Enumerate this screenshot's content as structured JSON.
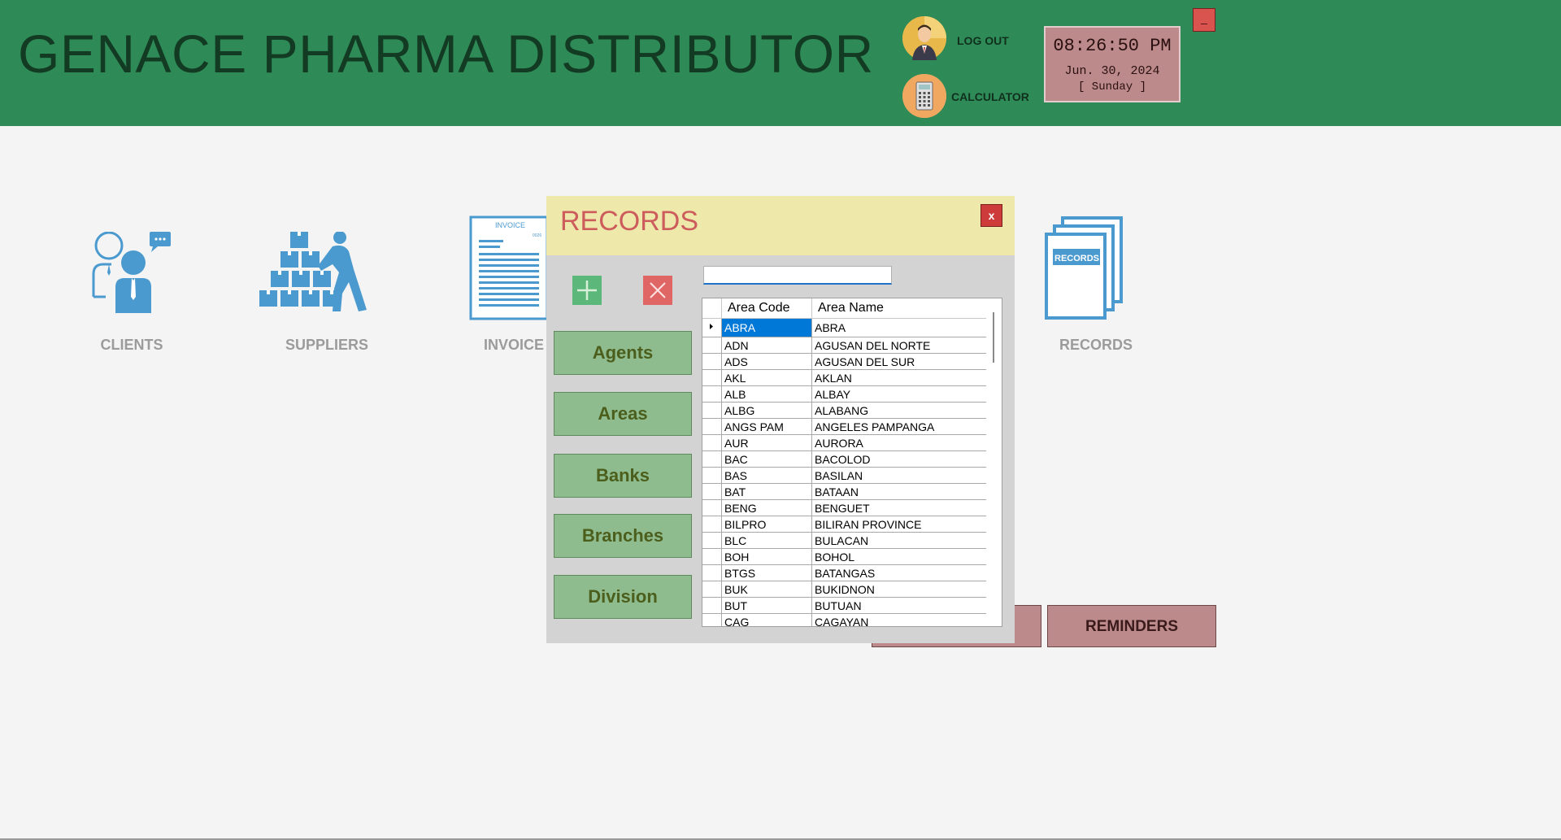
{
  "header": {
    "title": "GENACE PHARMA DISTRIBUTOR",
    "logout_label": "LOG OUT",
    "calculator_label": "CALCULATOR",
    "minimize_label": "_"
  },
  "clock": {
    "time": "08:26:50 PM",
    "date": "Jun. 30, 2024",
    "day": "[ Sunday ]"
  },
  "tiles": {
    "clients": "CLIENTS",
    "suppliers": "SUPPLIERS",
    "invoice": "INVOICE",
    "records": "RECORDS",
    "invoice_icon_text": "INVOICE",
    "records_icon_text": "RECORDS"
  },
  "bottom_buttons": {
    "reminders": "REMINDERS"
  },
  "dialog": {
    "title": "RECORDS",
    "close_label": "x",
    "search_value": "",
    "categories": [
      "Agents",
      "Areas",
      "Banks",
      "Branches",
      "Division"
    ],
    "columns": [
      "Area Code",
      "Area Name"
    ],
    "rows": [
      [
        "ABRA",
        "ABRA"
      ],
      [
        "ADN",
        "AGUSAN DEL NORTE"
      ],
      [
        "ADS",
        "AGUSAN DEL SUR"
      ],
      [
        "AKL",
        "AKLAN"
      ],
      [
        "ALB",
        "ALBAY"
      ],
      [
        "ALBG",
        "ALABANG"
      ],
      [
        "ANGS PAM",
        "ANGELES PAMPANGA"
      ],
      [
        "AUR",
        "AURORA"
      ],
      [
        "BAC",
        "BACOLOD"
      ],
      [
        "BAS",
        "BASILAN"
      ],
      [
        "BAT",
        "BATAAN"
      ],
      [
        "BENG",
        "BENGUET"
      ],
      [
        "BILPRO",
        "BILIRAN PROVINCE"
      ],
      [
        "BLC",
        "BULACAN"
      ],
      [
        "BOH",
        "BOHOL"
      ],
      [
        "BTGS",
        "BATANGAS"
      ],
      [
        "BUK",
        "BUKIDNON"
      ],
      [
        "BUT",
        "BUTUAN"
      ],
      [
        "CAG",
        "CAGAYAN"
      ]
    ]
  },
  "colors": {
    "header_bg": "#2e8b57",
    "dialog_header_bg": "#eee8aa",
    "dialog_title": "#cd5c5c",
    "category_button": "#8fbc8f",
    "selection": "#0078d7",
    "clock_bg": "#bc8a8a"
  }
}
